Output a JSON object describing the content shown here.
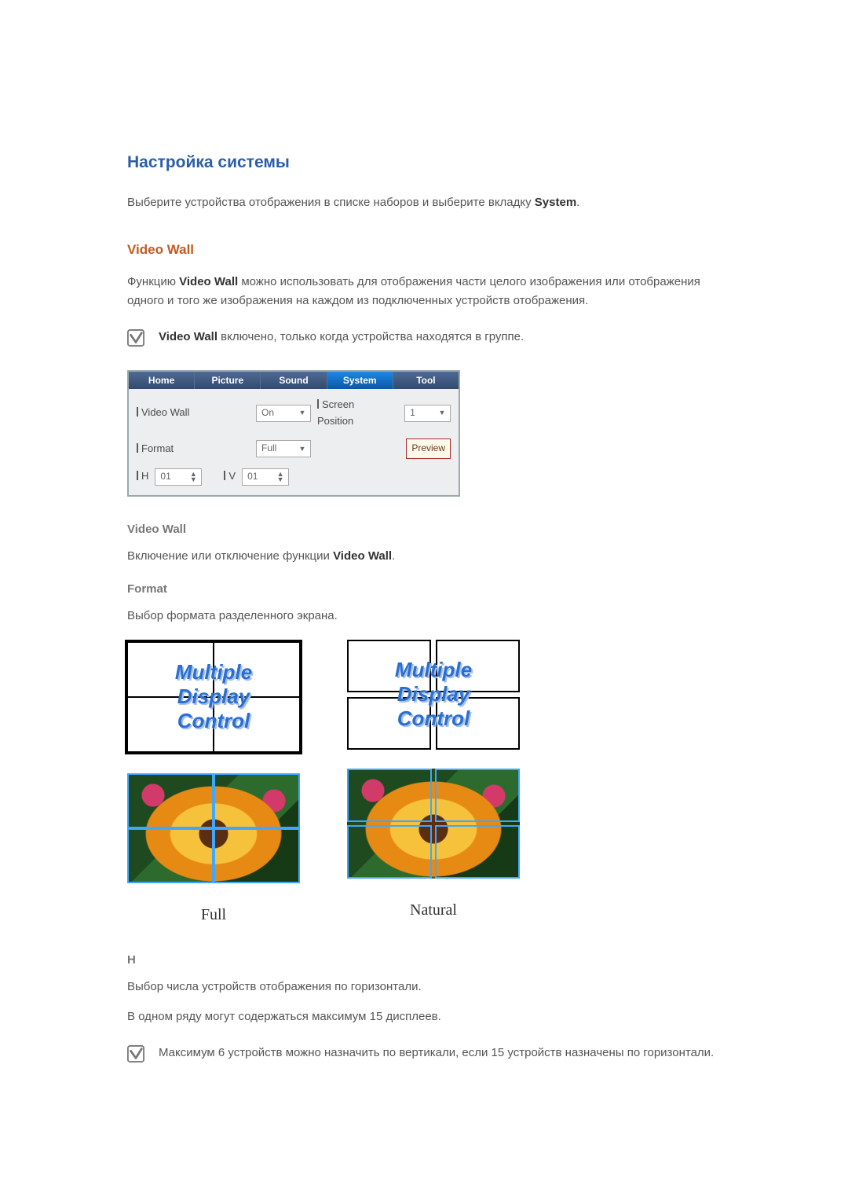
{
  "heading": "Настройка системы",
  "intro_prefix": "Выберите устройства отображения в списке наборов и выберите вкладку ",
  "intro_bold": "System",
  "intro_suffix": ".",
  "section": "Video Wall",
  "videowall_desc_prefix": "Функцию ",
  "videowall_desc_bold": "Video Wall",
  "videowall_desc_suffix": " можно использовать для отображения части целого изображения или отображения одного и того же изображения на каждом из подключенных устройств отображения.",
  "note1_bold": "Video Wall",
  "note1_suffix": " включено, только когда устройства находятся в группе.",
  "panel": {
    "tabs": [
      "Home",
      "Picture",
      "Sound",
      "System",
      "Tool"
    ],
    "active_tab_index": 3,
    "video_wall_label": "Video Wall",
    "video_wall_value": "On",
    "screen_position_label": "Screen Position",
    "screen_position_value": "1",
    "format_label": "Format",
    "format_value": "Full",
    "preview_label": "Preview",
    "h_label": "H",
    "h_value": "01",
    "v_label": "V",
    "v_value": "01"
  },
  "sub_videowall": "Video Wall",
  "sub_videowall_text_prefix": "Включение или отключение функции ",
  "sub_videowall_text_bold": "Video Wall",
  "sub_videowall_text_suffix": ".",
  "sub_format": "Format",
  "sub_format_text": "Выбор формата разделенного экрана.",
  "thumb_text": {
    "line1": "Multiple",
    "line2": "Display",
    "line3": "Control"
  },
  "format_names": {
    "full": "Full",
    "natural": "Natural"
  },
  "sub_h": "H",
  "sub_h_text1": "Выбор числа устройств отображения по горизонтали.",
  "sub_h_text2": "В одном ряду могут содержаться максимум 15 дисплеев.",
  "note2": "Максимум 6 устройств можно назначить по вертикали, если 15 устройств назначены по горизонтали."
}
